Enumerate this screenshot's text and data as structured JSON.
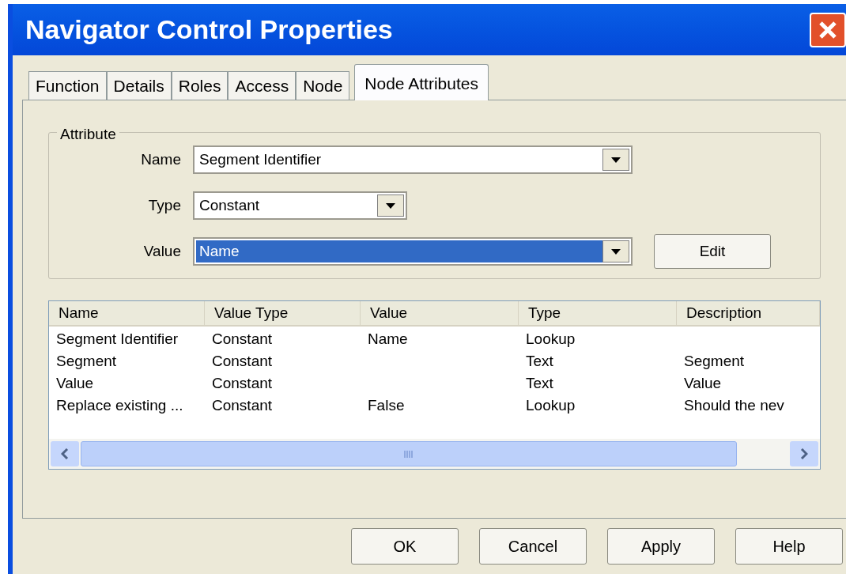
{
  "window": {
    "title": "Navigator Control Properties"
  },
  "tabs": [
    {
      "label": "Function",
      "selected": false
    },
    {
      "label": "Details",
      "selected": false
    },
    {
      "label": "Roles",
      "selected": false
    },
    {
      "label": "Access",
      "selected": false
    },
    {
      "label": "Node",
      "selected": false
    },
    {
      "label": "Node Attributes",
      "selected": true
    }
  ],
  "attribute_group": {
    "label": "Attribute",
    "fields": [
      {
        "label": "Name",
        "value": "Segment Identifier",
        "kind": "combo",
        "highlighted": false
      },
      {
        "label": "Type",
        "value": "Constant",
        "kind": "short_combo",
        "highlighted": false
      },
      {
        "label": "Value",
        "value": "Name",
        "kind": "combo",
        "highlighted": true
      }
    ],
    "edit_button": "Edit"
  },
  "list": {
    "columns": [
      "Name",
      "Value Type",
      "Value",
      "Type",
      "Description"
    ],
    "rows": [
      [
        "Segment Identifier",
        "Constant",
        "Name",
        "Lookup",
        ""
      ],
      [
        "Segment",
        "Constant",
        "",
        "Text",
        "Segment"
      ],
      [
        "Value",
        "Constant",
        "",
        "Text",
        "Value"
      ],
      [
        "Replace existing ...",
        "Constant",
        "False",
        "Lookup",
        "Should the nev"
      ]
    ]
  },
  "buttons": [
    "OK",
    "Cancel",
    "Apply",
    "Help"
  ]
}
